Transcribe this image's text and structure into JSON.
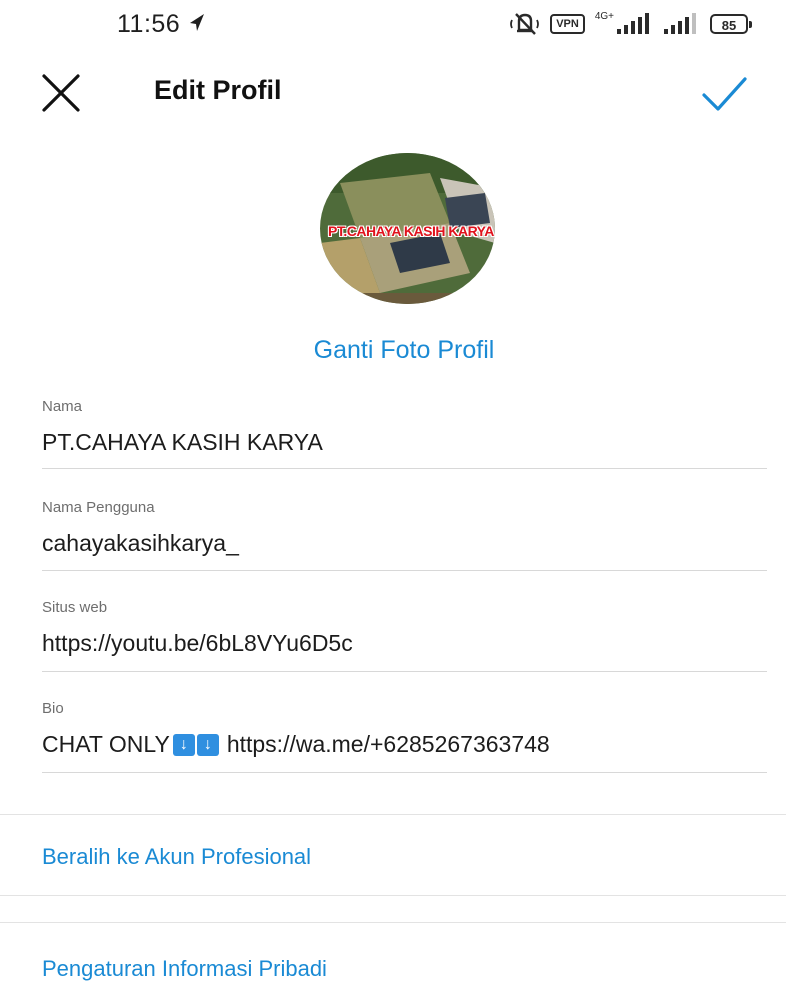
{
  "status_bar": {
    "time": "11:56",
    "vpn": "VPN",
    "network": "4G+",
    "battery": "85"
  },
  "header": {
    "title": "Edit Profil"
  },
  "avatar": {
    "overlay_text": "PT.CAHAYA KASIH KARYA"
  },
  "change_photo_label": "Ganti Foto Profil",
  "fields": {
    "name": {
      "label": "Nama",
      "value": "PT.CAHAYA KASIH KARYA"
    },
    "username": {
      "label": "Nama Pengguna",
      "value": "cahayakasihkarya_"
    },
    "website": {
      "label": "Situs web",
      "value": "https://youtu.be/6bL8VYu6D5c"
    },
    "bio": {
      "label": "Bio",
      "prefix": "CHAT ONLY",
      "link": "https://wa.me/+6285267363748"
    }
  },
  "links": {
    "professional": "Beralih ke Akun Profesional",
    "personal_info": "Pengaturan Informasi Pribadi"
  },
  "colors": {
    "accent": "#1a8ad4",
    "text": "#1c1c1c",
    "label": "#6e6e6e",
    "divider": "#d8d8d8"
  }
}
